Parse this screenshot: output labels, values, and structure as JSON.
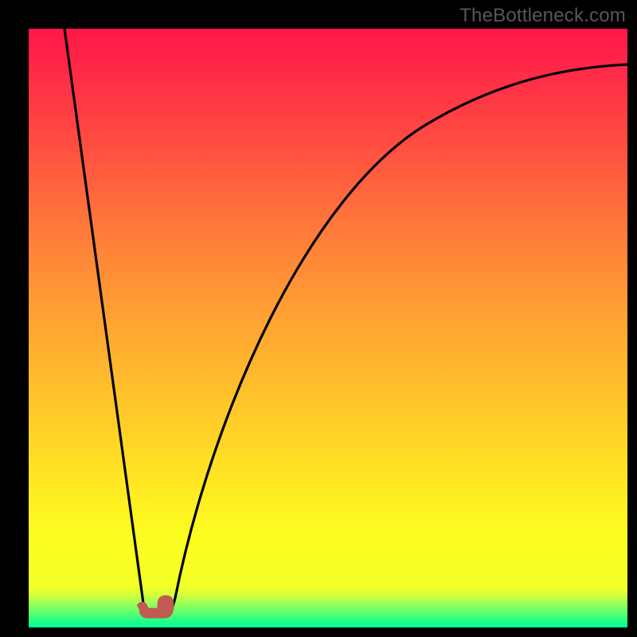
{
  "attribution": "TheBottleneck.com",
  "colors": {
    "frame": "#000000",
    "gradient_top": "#ff1647",
    "gradient_mid": "#ffe922",
    "gradient_bottom": "#03ff93",
    "curve": "#000000",
    "marker": "#c05a53",
    "attribution_text": "#555759"
  },
  "chart_data": {
    "type": "line",
    "title": "",
    "xlabel": "",
    "ylabel": "",
    "xlim": [
      0,
      100
    ],
    "ylim": [
      0,
      100
    ],
    "annotations": [
      "TheBottleneck.com"
    ],
    "legend": false,
    "grid": false,
    "series": [
      {
        "name": "left-descent",
        "x": [
          6,
          8,
          10,
          12,
          14,
          16,
          18,
          19.5
        ],
        "values": [
          100,
          86,
          71,
          57,
          43,
          29,
          14,
          3
        ]
      },
      {
        "name": "valley-floor",
        "x": [
          19.5,
          21,
          22.5,
          24
        ],
        "values": [
          3,
          2,
          2,
          3
        ]
      },
      {
        "name": "right-ascent",
        "x": [
          24,
          27,
          30,
          34,
          38,
          43,
          48,
          55,
          62,
          70,
          78,
          86,
          94,
          100
        ],
        "values": [
          3,
          20,
          36,
          52,
          63,
          72,
          78,
          83,
          86.5,
          89,
          90.5,
          91.5,
          92,
          92.5
        ]
      }
    ],
    "markers": [
      {
        "name": "valley-marker-left",
        "x": 19.5,
        "y": 3
      },
      {
        "name": "valley-marker-right",
        "x": 23.0,
        "y": 3
      }
    ]
  }
}
